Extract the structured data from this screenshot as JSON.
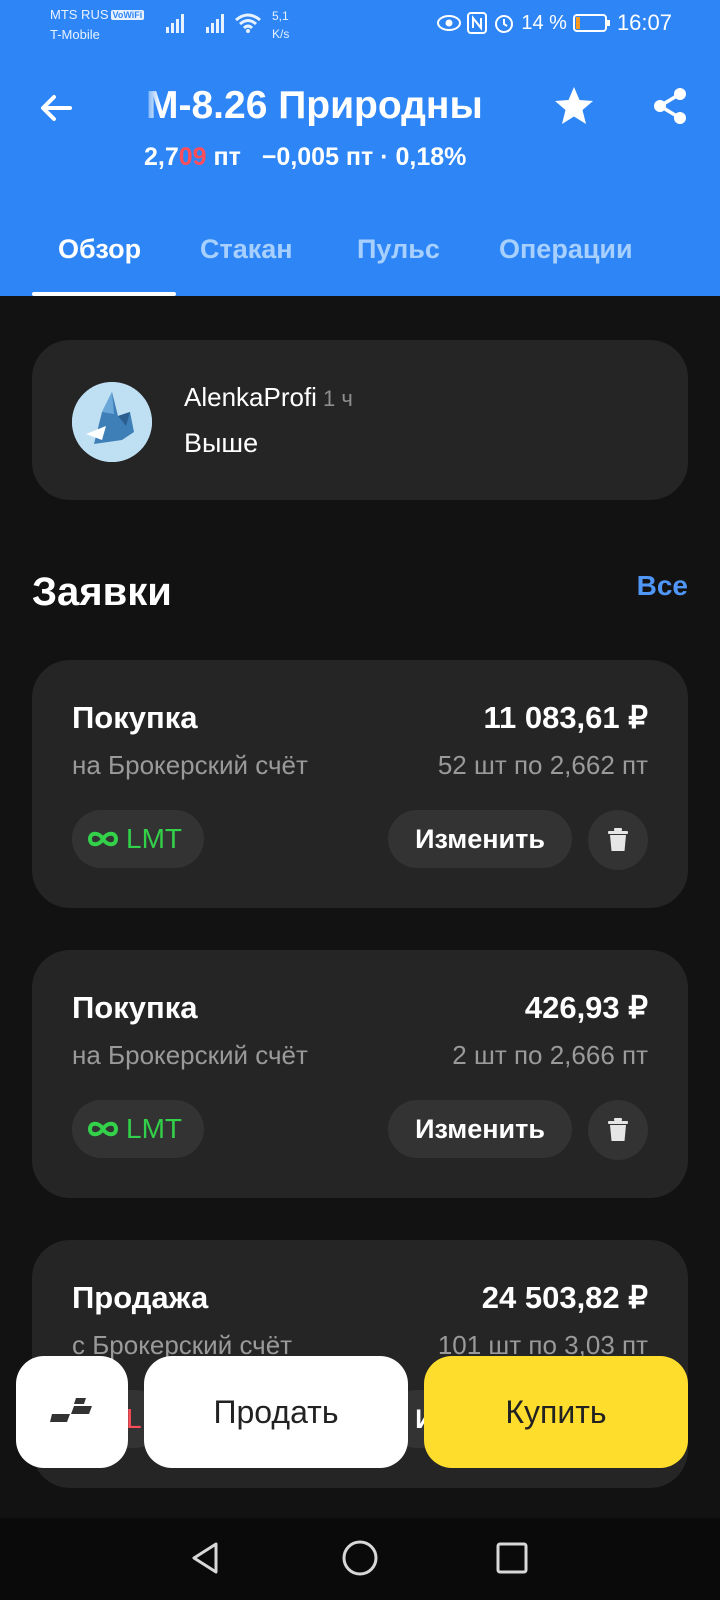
{
  "status_bar": {
    "carrier1": "MTS RUS",
    "vowifi": "VoWiFi",
    "carrier2": "T-Mobile",
    "speed_value": "5,1",
    "speed_unit": "K/s",
    "battery": "14 %",
    "battery_level": 0.14,
    "time": "16:07"
  },
  "header": {
    "title": "M-8.26 Природны",
    "price_main": "2,7",
    "price_red": "09",
    "price_unit": " пт",
    "change": "−0,005 пт · 0,18%"
  },
  "tabs": [
    {
      "label": "Обзор",
      "active": true
    },
    {
      "label": "Стакан",
      "active": false
    },
    {
      "label": "Пульс",
      "active": false
    },
    {
      "label": "Операции",
      "active": false
    }
  ],
  "post": {
    "author": "AlenkaProfi",
    "time": "1 ч",
    "text": "Выше"
  },
  "orders_section": {
    "title": "Заявки",
    "all_link": "Все"
  },
  "orders": [
    {
      "type": "Покупка",
      "account": "на Брокерский счёт",
      "sum": "11 083,61 ₽",
      "detail": "52 шт по 2,662 пт",
      "tag": "LMT",
      "edit_label": "Изменить"
    },
    {
      "type": "Покупка",
      "account": "на Брокерский счёт",
      "sum": "426,93 ₽",
      "detail": "2 шт по 2,666 пт",
      "tag": "LMT",
      "edit_label": "Изменить"
    },
    {
      "type": "Продажа",
      "account": "с Брокерский счёт",
      "sum": "24 503,82 ₽",
      "detail": "101 шт по 3,03 пт",
      "tag": "L",
      "edit_label": "Изменить"
    }
  ],
  "actions": {
    "sell": "Продать",
    "buy": "Купить"
  },
  "colors": {
    "header_bg": "#2e86f6",
    "buy_button": "#ffdd2d",
    "lmt_green": "#33d04a",
    "price_red": "#ff4d5a",
    "link_blue": "#4f96f7"
  }
}
